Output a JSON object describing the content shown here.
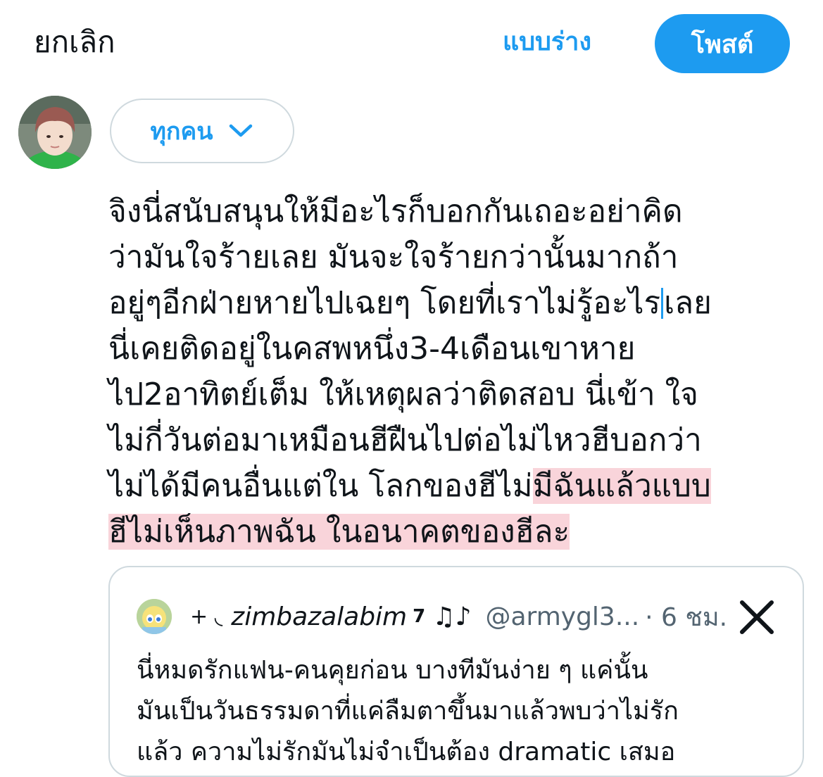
{
  "header": {
    "cancel_label": "ยกเลิก",
    "drafts_label": "แบบร่าง",
    "post_label": "โพสต์"
  },
  "composer": {
    "audience_label": "ทุกคน",
    "audience_icon": "chevron-down-icon",
    "text_lines": [
      "จิงนี่สนับสนุนให้มีอะไรก็บอกกันเถอะอย่าคิด",
      "ว่ามันใจร้ายเลย มันจะใจร้ายกว่านั้นมากถ้า",
      "อยู่ๆอีกฝ่ายหายไปเฉยๆ โดยที่เราไม่รู้อะไร",
      "เลย",
      "นี่เคยติดอยู่ในคสพหนึ่ง3-4เดือนเขาหาย",
      "ไป2อาทิตย์เต็ม ให้เหตุผลว่าติดสอบ นี่เข้า ใจ",
      "ไม่กี่วันต่อมาเหมือนฮีฝืนไปต่อไม่ไหวฮีบอกว่า",
      "ไม่ได้มีคนอื่นแต่ใน โลกของฮีไม่",
      "มีฉันแล้วแบบ",
      "ฮีไม่เห็นภาพฉัน ในอนาคตของฮีละ"
    ],
    "highlight_color": "#f9d4da"
  },
  "quote": {
    "prefix": "+ ◟",
    "name": "zimbazalabim",
    "badge": "7",
    "notes": "♫♪",
    "handle": "@armygl3...",
    "time": "· 6 ชม.",
    "close_icon": "close-icon",
    "text_lines": [
      "นี่หมดรักแฟน-คนคุยก่อน บางทีมันง่าย ๆ แค่นั้น",
      "มันเป็นวันธรรมดาที่แค่ลืมตาขึ้นมาแล้วพบว่าไม่รัก",
      "แล้ว ความไม่รักมันไม่จำเป็นต้อง dramatic เสมอ"
    ]
  },
  "colors": {
    "accent": "#1d9bf0",
    "text": "#0f1419",
    "secondary_text": "#536471",
    "border": "#cfd9de"
  }
}
